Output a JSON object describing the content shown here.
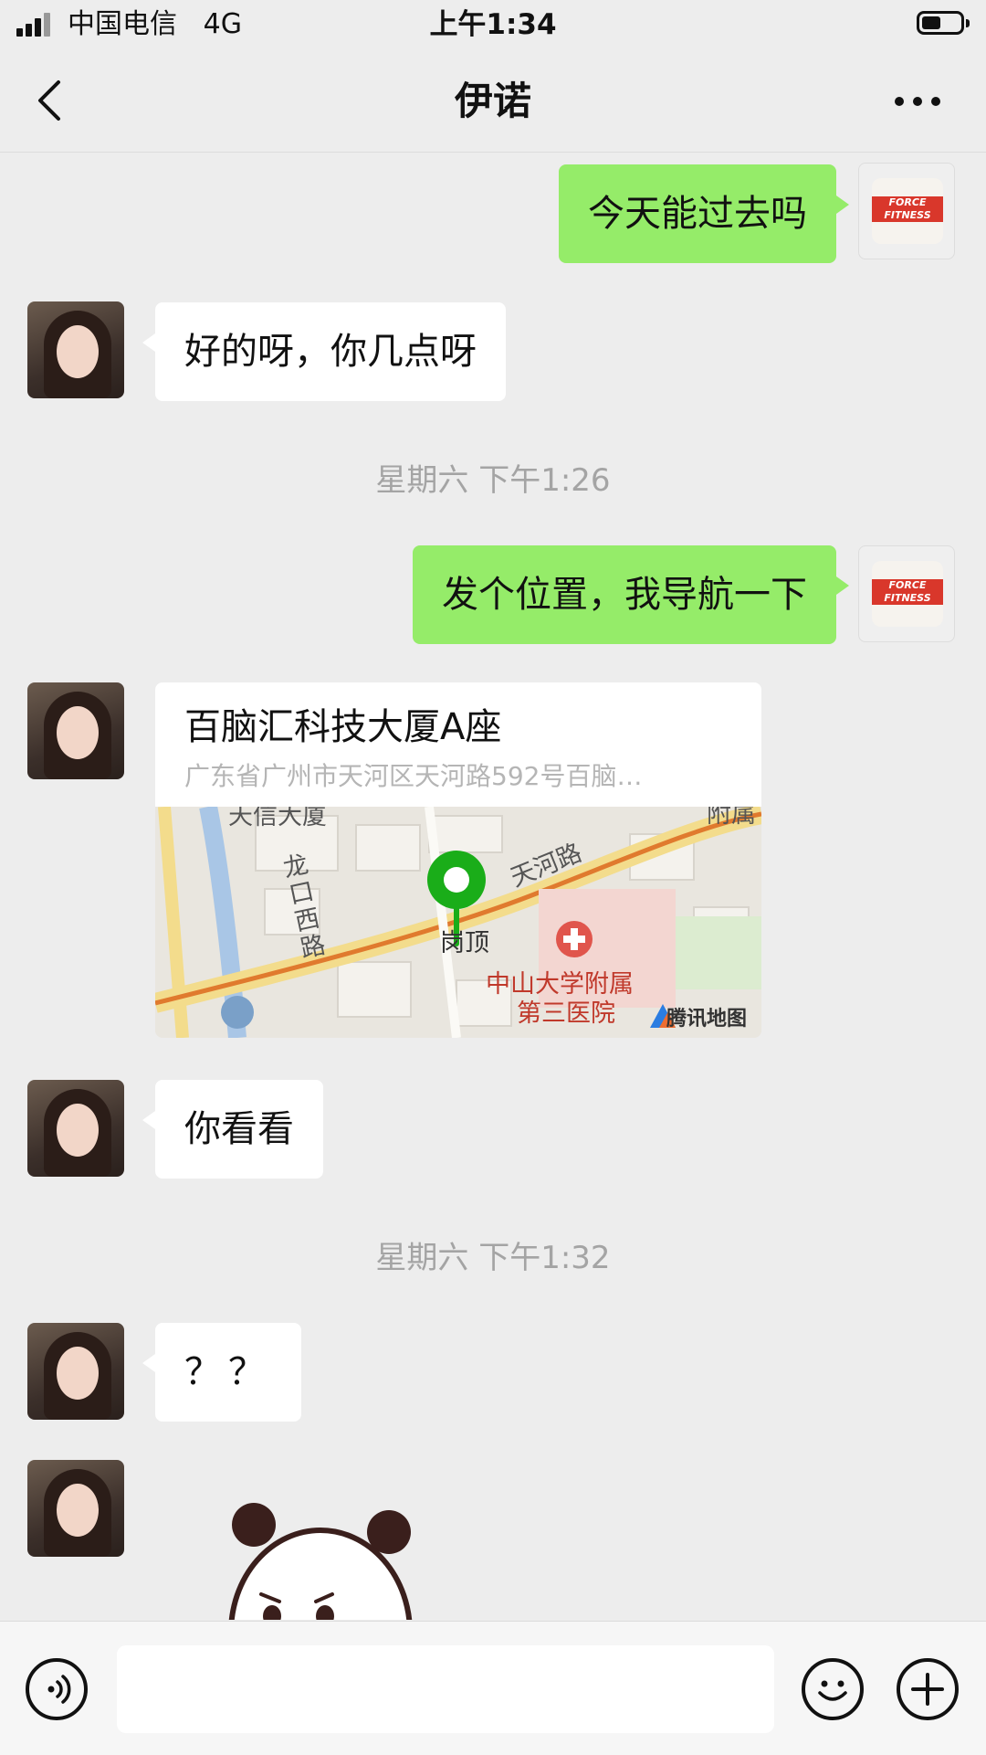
{
  "status_bar": {
    "carrier": "中国电信",
    "network": "4G",
    "time": "上午1:34",
    "battery_level": 0.55
  },
  "nav": {
    "title": "伊诺",
    "back_icon": "chevron-left-icon",
    "more_icon": "more-dots-icon"
  },
  "messages": [
    {
      "from": "me",
      "text": "今天能过去吗"
    },
    {
      "from": "her",
      "text": "好的呀，你几点呀"
    },
    {
      "type": "time",
      "text": "星期六 下午1:26"
    },
    {
      "from": "me",
      "text": "发个位置，我导航一下"
    },
    {
      "from": "her",
      "type": "location",
      "name": "百脑汇科技大厦A座",
      "address": "广东省广州市天河区天河路592号百脑…",
      "map_labels": {
        "building": "天信大厦",
        "road_1": "龙口西路",
        "road_2": "天河路",
        "area": "岗顶",
        "hospital_1": "中山大学附属",
        "hospital_2": "第三医院",
        "corner": "附属",
        "provider": "腾讯地图"
      }
    },
    {
      "from": "her",
      "text": "你看看"
    },
    {
      "type": "time",
      "text": "星期六 下午1:32"
    },
    {
      "from": "her",
      "text": "？？"
    },
    {
      "from": "her",
      "type": "sticker",
      "sticker": "panda-sticker"
    }
  ],
  "input_bar": {
    "voice_icon": "voice-icon",
    "emoji_icon": "emoji-icon",
    "plus_icon": "plus-icon",
    "text_value": ""
  },
  "colors": {
    "background": "#ededed",
    "outgoing_bubble": "#95ec69",
    "incoming_bubble": "#ffffff",
    "map_pin": "#1aad19"
  }
}
